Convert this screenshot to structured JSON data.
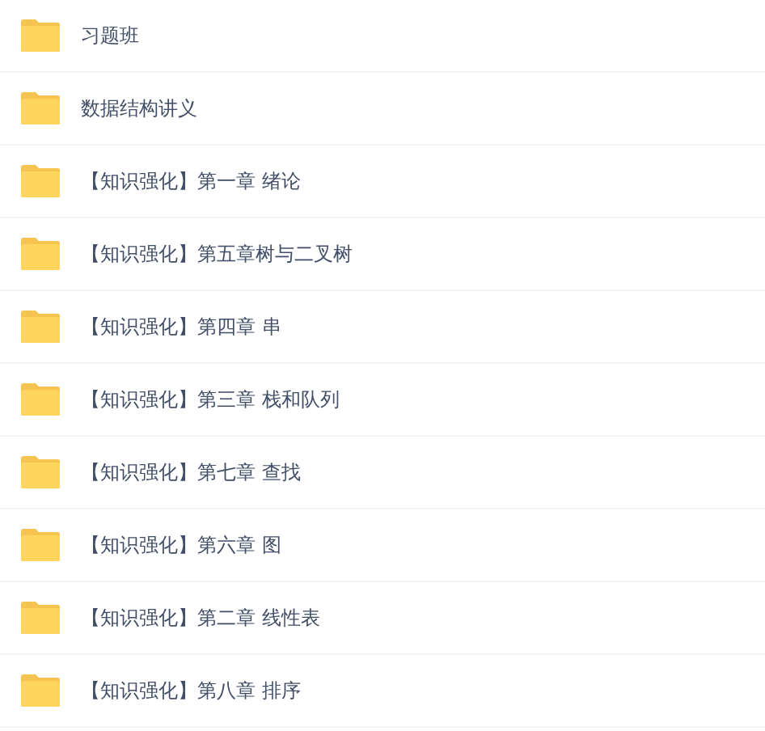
{
  "files": [
    {
      "name": "习题班"
    },
    {
      "name": "数据结构讲义"
    },
    {
      "name": "【知识强化】第一章 绪论"
    },
    {
      "name": "【知识强化】第五章树与二叉树"
    },
    {
      "name": "【知识强化】第四章 串"
    },
    {
      "name": "【知识强化】第三章 栈和队列"
    },
    {
      "name": "【知识强化】第七章 查找"
    },
    {
      "name": "【知识强化】第六章 图"
    },
    {
      "name": "【知识强化】第二章 线性表"
    },
    {
      "name": "【知识强化】第八章 排序"
    }
  ]
}
